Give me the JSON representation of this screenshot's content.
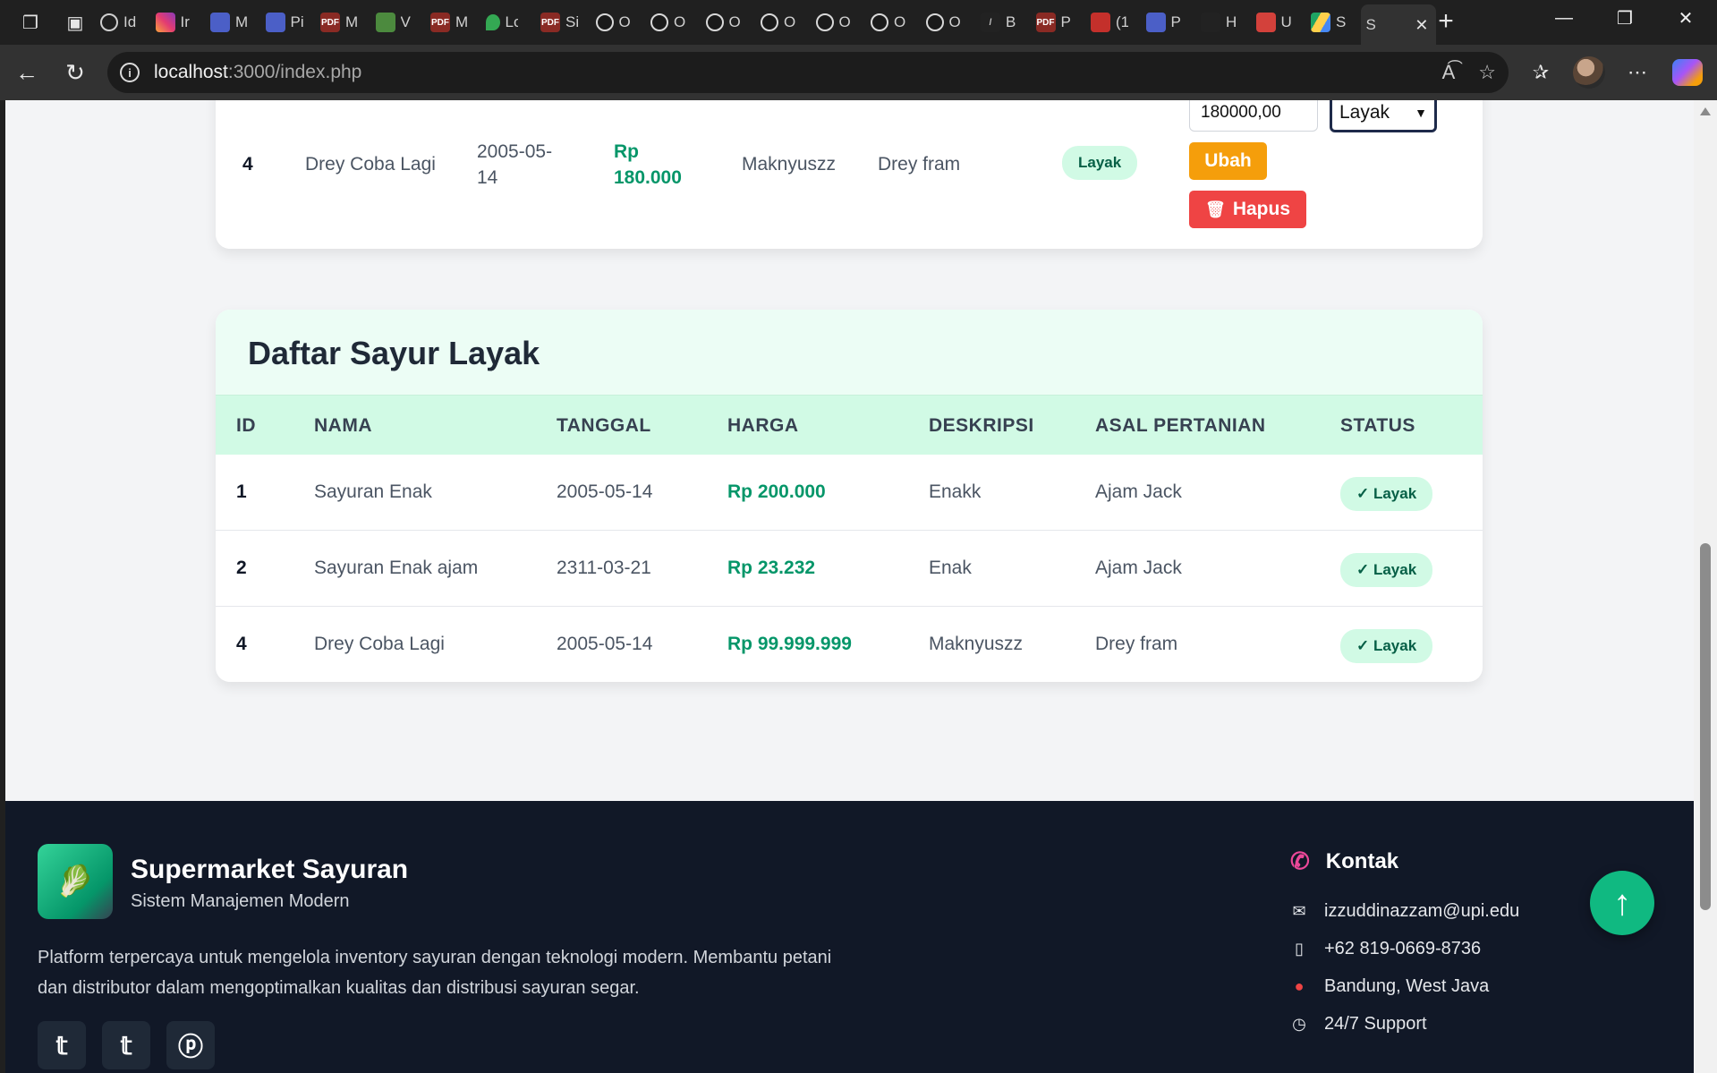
{
  "browser": {
    "tabs": [
      {
        "fav": "web",
        "label": "Id"
      },
      {
        "fav": "instagram",
        "label": "Ir"
      },
      {
        "fav": "doc",
        "label": "M"
      },
      {
        "fav": "doc",
        "label": "Pi"
      },
      {
        "fav": "pdf",
        "label": "M"
      },
      {
        "fav": "green",
        "label": "V"
      },
      {
        "fav": "pdf",
        "label": "M"
      },
      {
        "fav": "maps",
        "label": "Lo"
      },
      {
        "fav": "pdf",
        "label": "Si"
      },
      {
        "fav": "github",
        "label": "O"
      },
      {
        "fav": "github",
        "label": "O"
      },
      {
        "fav": "github",
        "label": "O"
      },
      {
        "fav": "github",
        "label": "O"
      },
      {
        "fav": "github",
        "label": "O"
      },
      {
        "fav": "github",
        "label": "O"
      },
      {
        "fav": "github",
        "label": "O"
      },
      {
        "fav": "pen",
        "label": "B"
      },
      {
        "fav": "pdf",
        "label": "P"
      },
      {
        "fav": "youtube",
        "label": "(1"
      },
      {
        "fav": "doc",
        "label": "P"
      },
      {
        "fav": "orange",
        "label": "H"
      },
      {
        "fav": "red",
        "label": "U"
      },
      {
        "fav": "drive",
        "label": "S"
      }
    ],
    "active_tab": {
      "label": "S"
    },
    "url_host": "localhost",
    "url_path": ":3000/index.php"
  },
  "top_row": {
    "id": "4",
    "nama": "Drey Coba Lagi",
    "tanggal_line1": "2005-05-",
    "tanggal_line2": "14",
    "harga_line1": "Rp",
    "harga_line2": "180.000",
    "deskripsi": "Maknyuszz",
    "asal": "Drey fram",
    "status": "Layak",
    "price_input_value": "180000,00",
    "select_value": "Layak",
    "ubah_label": "Ubah",
    "hapus_label": "Hapus"
  },
  "layak": {
    "title": "Daftar Sayur Layak",
    "headers": [
      "ID",
      "NAMA",
      "TANGGAL",
      "HARGA",
      "DESKRIPSI",
      "ASAL PERTANIAN",
      "STATUS"
    ],
    "rows": [
      {
        "id": "1",
        "nama": "Sayuran Enak",
        "tanggal": "2005-05-14",
        "harga": "Rp 200.000",
        "deskripsi": "Enakk",
        "asal": "Ajam Jack",
        "status": "✓ Layak"
      },
      {
        "id": "2",
        "nama": "Sayuran Enak ajam",
        "tanggal": "2311-03-21",
        "harga": "Rp 23.232",
        "deskripsi": "Enak",
        "asal": "Ajam Jack",
        "status": "✓ Layak"
      },
      {
        "id": "4",
        "nama": "Drey Coba Lagi",
        "tanggal": "2005-05-14",
        "harga": "Rp 99.999.999",
        "deskripsi": "Maknyuszz",
        "asal": "Drey fram",
        "status": "✓ Layak"
      }
    ]
  },
  "footer": {
    "brand": "Supermarket Sayuran",
    "tagline": "Sistem Manajemen Modern",
    "description": "Platform terpercaya untuk mengelola inventory sayuran dengan teknologi modern. Membantu petani dan distributor dalam mengoptimalkan kualitas dan distribusi sayuran segar.",
    "social": [
      "twitter-icon",
      "twitter-icon",
      "pinterest-icon"
    ],
    "kontak_title": "Kontak",
    "email": "izzuddinazzam@upi.edu",
    "phone": "+62 819-0669-8736",
    "location": "Bandung, West Java",
    "support": "24/7 Support"
  },
  "colors": {
    "accent": "#10b981",
    "price": "#059669",
    "ubah": "#f59e0b",
    "hapus": "#ef4444",
    "footer_bg": "#111827"
  }
}
